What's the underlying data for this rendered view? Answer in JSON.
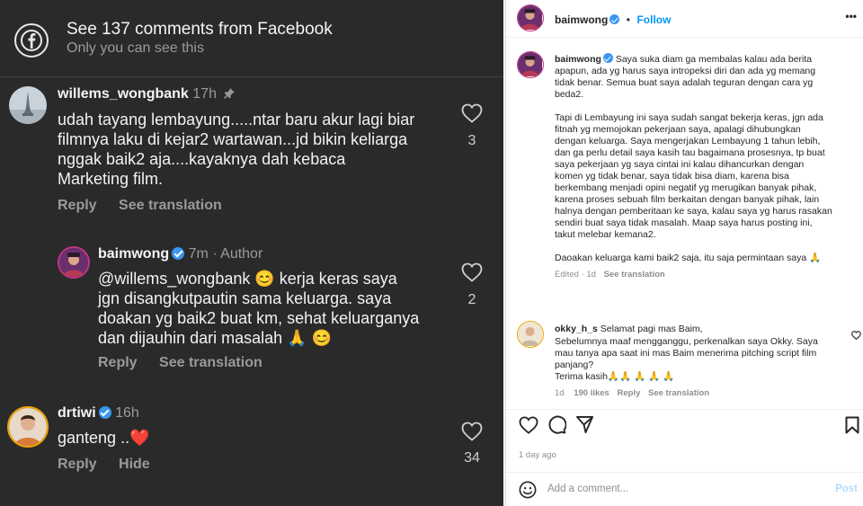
{
  "left": {
    "header": {
      "title": "See 137 comments from Facebook",
      "subtitle": "Only you can see this"
    },
    "comments": [
      {
        "username": "willems_wongbank",
        "time": "17h",
        "text_lines": [
          "udah tayang lembayung.....ntar baru akur lagi biar",
          "filmnya laku di kejar2 wartawan...jd bikin keliarga",
          "nggak baik2 aja....kayaknya dah kebaca",
          "Marketing film."
        ],
        "actions": [
          "Reply",
          "See translation"
        ],
        "likes": "3"
      },
      {
        "username": "baimwong",
        "time": "7m",
        "author_label": "· Author",
        "text_lines": [
          "@willems_wongbank 😊 kerja keras saya",
          "jgn disangkutpautin sama keluarga. saya",
          "doakan yg baik2 buat km, sehat keluarganya",
          "dan dijauhin dari masalah 🙏 😊"
        ],
        "actions": [
          "Reply",
          "See translation"
        ],
        "likes": "2"
      },
      {
        "username": "drtiwi",
        "time": "16h",
        "text_lines": [
          "ganteng ..❤️"
        ],
        "actions": [
          "Reply",
          "Hide"
        ],
        "likes": "34"
      }
    ]
  },
  "right": {
    "header": {
      "username": "baimwong",
      "follow_label": "Follow",
      "more_label": "•••"
    },
    "caption": {
      "username": "baimwong",
      "first_line": "Saya suka diam ga membalas kalau ada berita",
      "p1_lines": [
        "apapun, ada yg harus saya intropeksi diri dan ada yg memang",
        "tidak benar. Semua buat saya adalah teguran dengan cara yg",
        "beda2."
      ],
      "p2_lines": [
        "Tapi di Lembayung ini saya sudah sangat bekerja keras, jgn ada",
        "fitnah yg memojokan pekerjaan saya, apalagi dihubungkan",
        "dengan keluarga. Saya mengerjakan Lembayung 1 tahun lebih,",
        "dan ga perlu detail saya kasih tau bagaimana prosesnya, tp buat",
        "saya pekerjaan yg saya cintai ini kalau dihancurkan dengan",
        "komen yg tidak benar, saya tidak bisa diam, karena bisa",
        "berkembang menjadi opini negatif yg merugikan banyak pihak,",
        "karena proses sebuah film berkaitan dengan banyak pihak, lain",
        "halnya dengan pemberitaan ke saya, kalau saya yg harus rasakan",
        "sendiri buat saya tidak masalah. Maap saya harus posting ini,",
        "takut melebar kemana2."
      ],
      "p3_line": "Daoakan keluarga kami baik2 saja, itu saja permintaan saya 🙏",
      "edited": "Edited · 1d",
      "see_translation": "See translation"
    },
    "comment": {
      "username": "okky_h_s",
      "first_line": "Selamat pagi mas Baim,",
      "lines": [
        "Sebelumnya maaf mengganggu, perkenalkan saya Okky. Saya",
        "mau tanya apa saat ini mas Baim menerima pitching script film",
        "panjang?",
        "Terima kasih🙏🙏 🙏 🙏 🙏"
      ],
      "age": "1d",
      "likes": "190 likes",
      "reply": "Reply",
      "see_translation": "See translation"
    },
    "post_age": "1 day ago",
    "add_comment_placeholder": "Add a comment...",
    "post_label": "Post"
  }
}
